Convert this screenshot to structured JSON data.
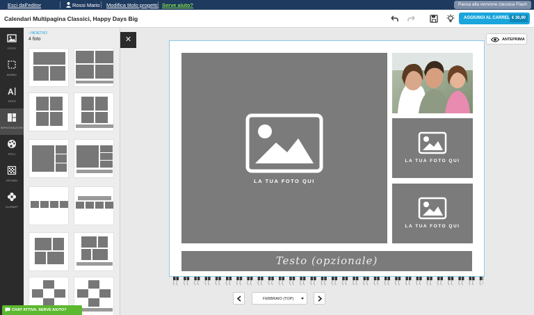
{
  "topbar": {
    "exit": "Esci dall'editor",
    "user": "Rossi Mario",
    "rename": "Modifica titolo progetto",
    "help": "Serve aiuto?",
    "flash": "Passa alla versione classica Flash"
  },
  "header": {
    "title": "Calendari Multipagina Classici, Happy Days Big",
    "cart_label": "AGGIUNGI AL CARRELLO",
    "cart_price": "€ 36,90"
  },
  "sidebar": {
    "items": [
      {
        "label": "FOTO",
        "icon": "photo-icon"
      },
      {
        "label": "BORDI",
        "icon": "border-icon"
      },
      {
        "label": "TESTI",
        "icon": "text-icon"
      },
      {
        "label": "IMPAGINAZIONI",
        "icon": "layout-icon"
      },
      {
        "label": "STILI",
        "icon": "palette-icon"
      },
      {
        "label": "SFONDI",
        "icon": "background-icon"
      },
      {
        "label": "CLIPART",
        "icon": "flower-icon"
      }
    ]
  },
  "panel": {
    "back": "INDIETRO",
    "count": "4 foto"
  },
  "canvas": {
    "preview": "ANTEPRIMA",
    "photo_placeholder": "LA TUA FOTO QUI",
    "text_placeholder": "Testo (opzionale)",
    "month": "FEBBRAIO (TOP)"
  },
  "chat": "CHAT ATTIVA. SERVE AIUTO?",
  "colors": {
    "topbar": "#1f3a5f",
    "accent": "#1aa5dc",
    "chat": "#5cb82e",
    "placeholder": "#7b7b7b"
  }
}
